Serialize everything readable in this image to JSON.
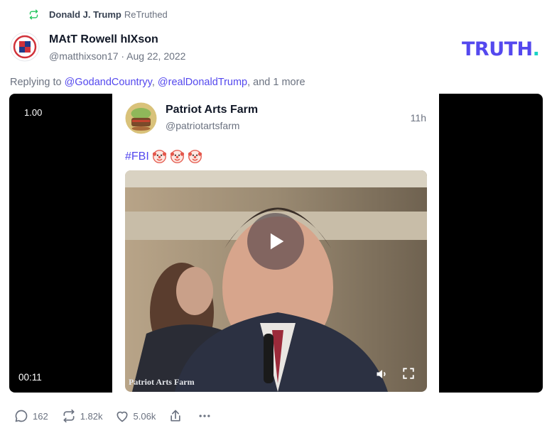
{
  "retruth": {
    "author": "Donald J. Trump",
    "verb": "ReTruthed"
  },
  "user": {
    "display_name": "MAtT Rowell hIXson",
    "handle": "@matthixson17",
    "separator": "·",
    "date": "Aug 22, 2022"
  },
  "brand": {
    "logo_text": "TRUTH",
    "logo_dot": ".",
    "primary_color": "#5448ee",
    "accent_color": "#19d3c5"
  },
  "replying": {
    "prefix": "Replying to",
    "mention_1": "@GodandCountryy",
    "comma": ",",
    "mention_2": "@realDonaldTrump",
    "suffix": ", and 1 more"
  },
  "video": {
    "playback_rate": "1.00",
    "current_time": "00:11",
    "frame": {
      "name": "Patriot Arts Farm",
      "handle": "@patriotartsfarm",
      "time": "11h",
      "text": "#FBI",
      "emoji": [
        "clown-face",
        "clown-face",
        "clown-face"
      ],
      "watermark": "Patriot Arts Farm"
    }
  },
  "actions": {
    "replies": "162",
    "retruths": "1.82k",
    "likes": "5.06k"
  }
}
